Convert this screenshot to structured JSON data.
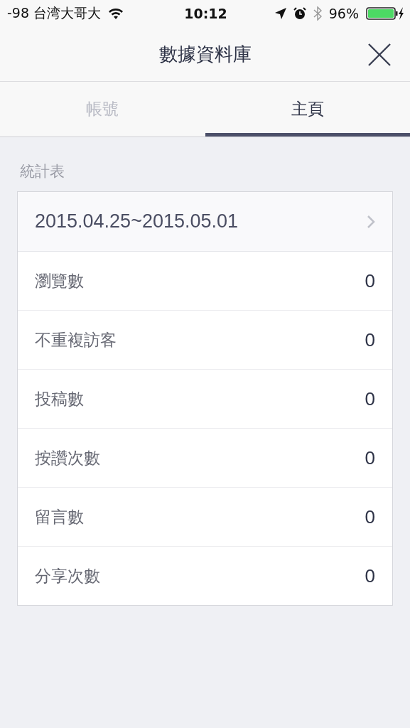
{
  "status_bar": {
    "carrier": "-98 台湾大哥大",
    "time": "10:12",
    "battery": "96%"
  },
  "header": {
    "title": "數據資料庫"
  },
  "tabs": [
    {
      "label": "帳號",
      "selected": false
    },
    {
      "label": "主頁",
      "selected": true
    }
  ],
  "section": {
    "title": "統計表"
  },
  "date_range": "2015.04.25~2015.05.01",
  "stats": [
    {
      "label": "瀏覽數",
      "value": "0"
    },
    {
      "label": "不重複訪客",
      "value": "0"
    },
    {
      "label": "投稿數",
      "value": "0"
    },
    {
      "label": "按讚次數",
      "value": "0"
    },
    {
      "label": "留言數",
      "value": "0"
    },
    {
      "label": "分享次數",
      "value": "0"
    }
  ]
}
